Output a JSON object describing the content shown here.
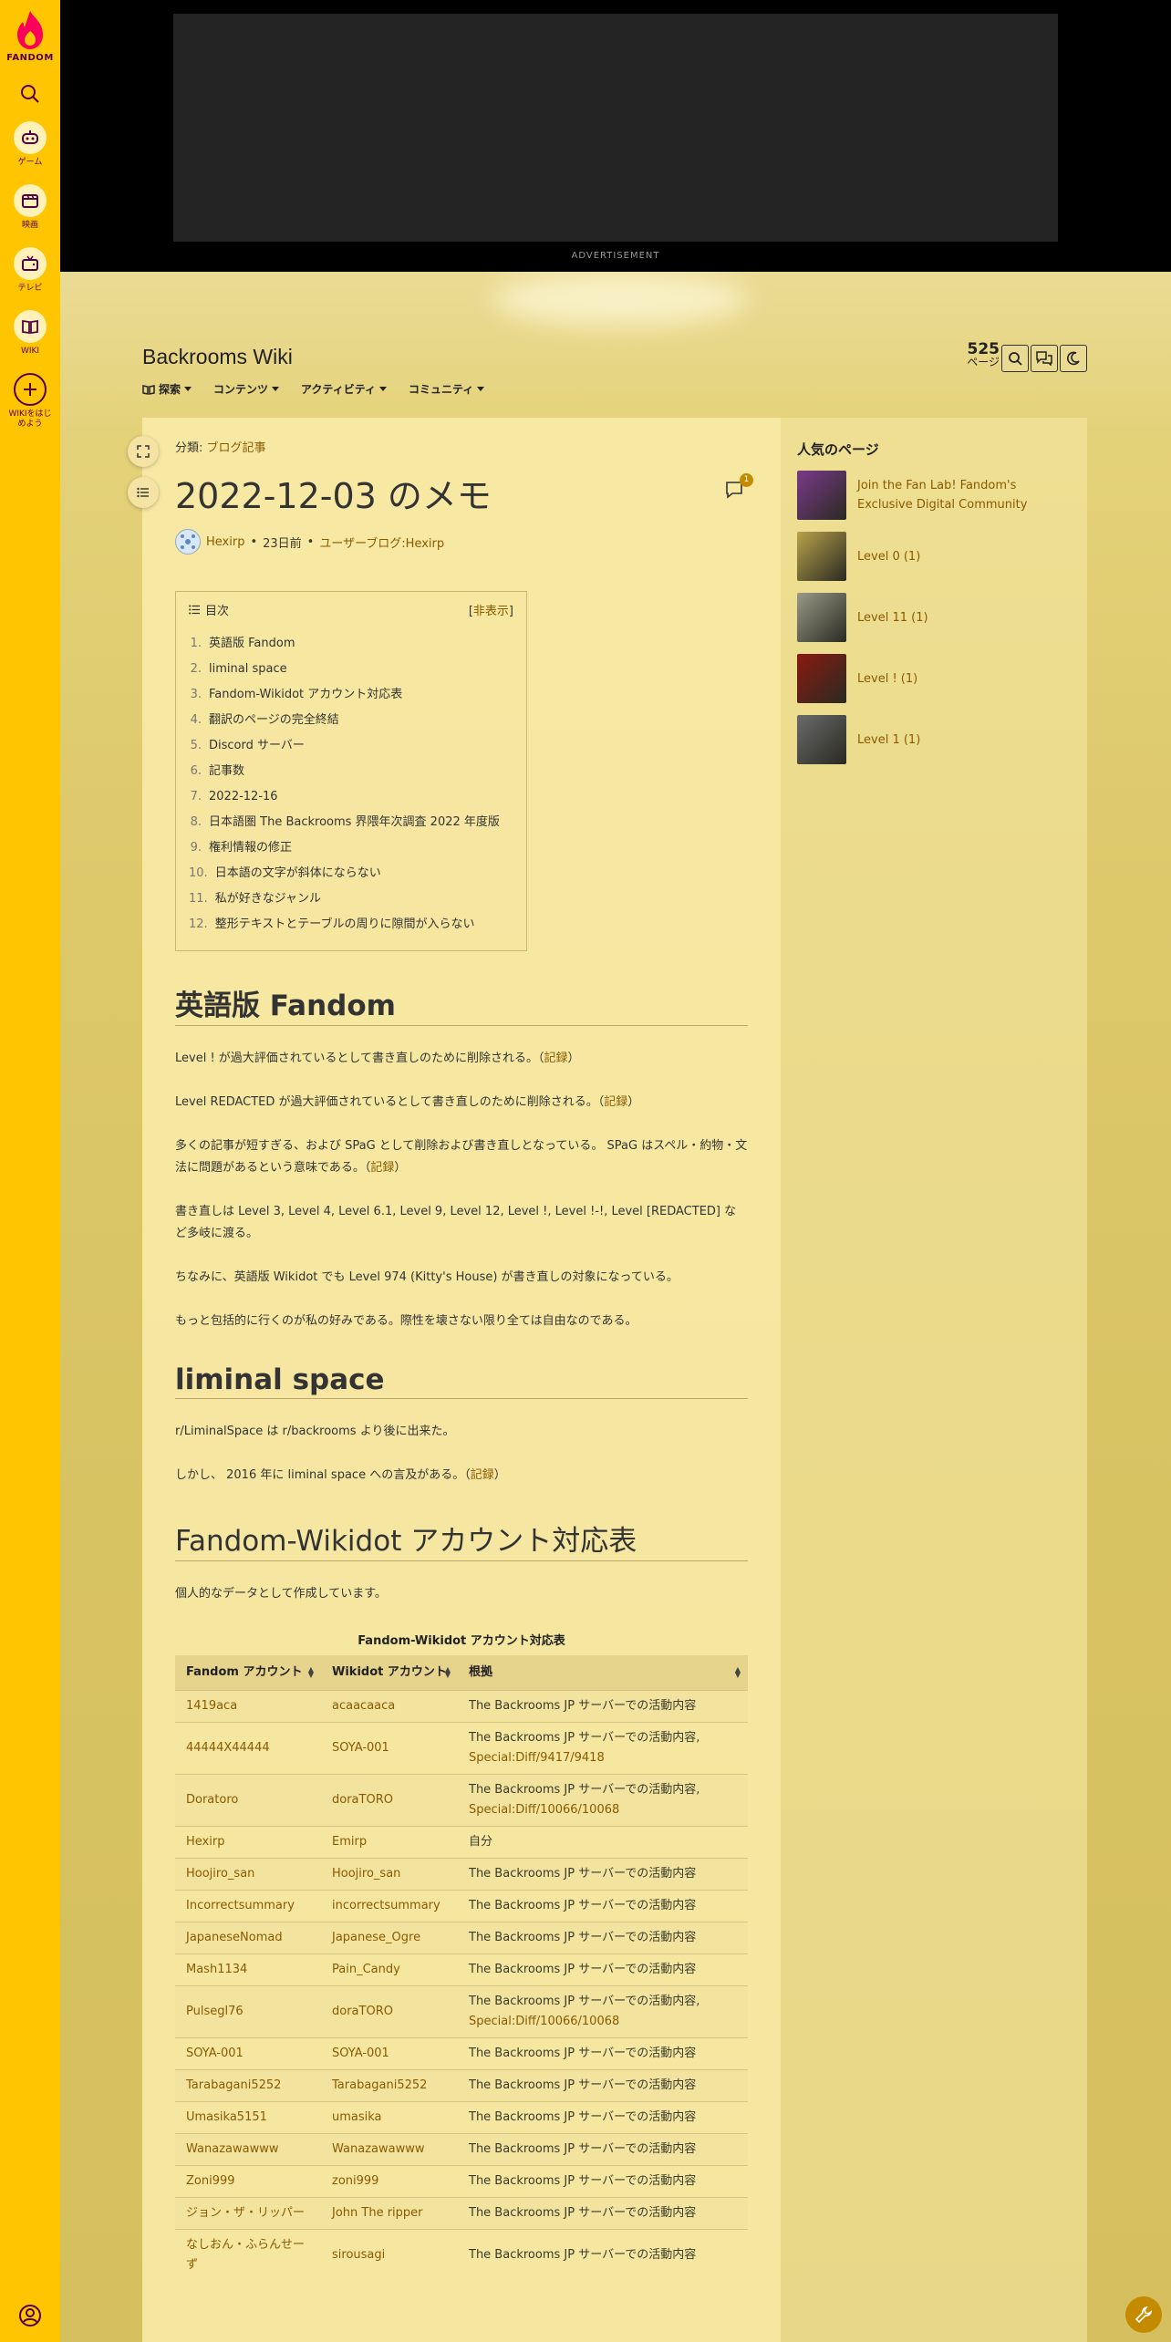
{
  "global_nav": {
    "logo_label": "FANDOM",
    "items": [
      {
        "label": "ゲーム",
        "icon": "gamepad-icon"
      },
      {
        "label": "映画",
        "icon": "film-icon"
      },
      {
        "label": "テレビ",
        "icon": "tv-icon"
      },
      {
        "label": "WIKI",
        "icon": "wiki-book-icon"
      }
    ],
    "start_wiki_label": "WIKIをはじめよう"
  },
  "ad": {
    "label": "ADVERTISEMENT"
  },
  "header": {
    "wiki_title": "Backrooms Wiki",
    "nav": [
      "探索",
      "コンテンツ",
      "アクティビティ",
      "コミュニティ"
    ],
    "page_count": "525",
    "page_count_unit": "ページ"
  },
  "article": {
    "category_prefix": "分類:",
    "category": "ブログ記事",
    "title": "2022-12-03 のメモ",
    "comment_count": "1",
    "author": "Hexirp",
    "time": "23日前",
    "blog": "ユーザーブログ:Hexirp",
    "sep": "•"
  },
  "toc": {
    "title": "目次",
    "hide_label": "非表示",
    "items": [
      {
        "n": "1.",
        "t": "英語版 Fandom"
      },
      {
        "n": "2.",
        "t": "liminal space"
      },
      {
        "n": "3.",
        "t": "Fandom-Wikidot アカウント対応表"
      },
      {
        "n": "4.",
        "t": "翻訳のページの完全終結"
      },
      {
        "n": "5.",
        "t": "Discord サーバー"
      },
      {
        "n": "6.",
        "t": "記事数"
      },
      {
        "n": "7.",
        "t": "2022-12-16"
      },
      {
        "n": "8.",
        "t": "日本語圏 The Backrooms 界隈年次調査 2022 年度版"
      },
      {
        "n": "9.",
        "t": "権利情報の修正"
      },
      {
        "n": "10.",
        "t": "日本語の文字が斜体にならない"
      },
      {
        "n": "11.",
        "t": "私が好きなジャンル"
      },
      {
        "n": "12.",
        "t": "整形テキストとテーブルの周りに隙間が入らない"
      }
    ]
  },
  "sections": {
    "s1": {
      "title": "英語版 Fandom",
      "p1": "Level ! が過大評価されているとして書き直しのために削除される。（",
      "p1_link": "記録",
      "p1_end": "）",
      "p2": "Level REDACTED が過大評価されているとして書き直しのために削除される。（",
      "p2_link": "記録",
      "p2_end": "）",
      "p3": "多くの記事が短すぎる、および SPaG として削除および書き直しとなっている。 SPaG はスペル・約物・文法に問題があるという意味である。（",
      "p3_link": "記録",
      "p3_end": "）",
      "p4": "書き直しは Level 3, Level 4, Level 6.1, Level 9, Level 12, Level !, Level !-!, Level [REDACTED] など多岐に渡る。",
      "p5": "ちなみに、英語版 Wikidot でも Level 974 (Kitty's House) が書き直しの対象になっている。",
      "p6": "もっと包括的に行くのが私の好みである。際性を壊さない限り全ては自由なのである。"
    },
    "s2": {
      "title": "liminal space",
      "p1": "r/LiminalSpace は r/backrooms より後に出来た。",
      "p2": "しかし、 2016 年に liminal space への言及がある。（",
      "p2_link": "記録",
      "p2_end": "）"
    },
    "s3": {
      "title": "Fandom-Wikidot アカウント対応表",
      "p1": "個人的なデータとして作成しています。",
      "caption": "Fandom-Wikidot アカウント対応表",
      "headers": [
        "Fandom アカウント",
        "Wikidot アカウント",
        "根拠"
      ],
      "rows": [
        {
          "f": "1419aca",
          "w": "acaacaaca",
          "r": "The Backrooms JP サーバーでの活動内容",
          "l": ""
        },
        {
          "f": "44444X44444",
          "w": "SOYA-001",
          "r": "The Backrooms JP サーバーでの活動内容,",
          "l": "Special:Diff/9417/9418"
        },
        {
          "f": "Doratoro",
          "w": "doraTORO",
          "r": "The Backrooms JP サーバーでの活動内容,",
          "l": "Special:Diff/10066/10068"
        },
        {
          "f": "Hexirp",
          "w": "Emirp",
          "r": "自分",
          "l": ""
        },
        {
          "f": "Hoojiro_san",
          "w": "Hoojiro_san",
          "r": "The Backrooms JP サーバーでの活動内容",
          "l": ""
        },
        {
          "f": "Incorrectsummary",
          "w": "incorrectsummary",
          "r": "The Backrooms JP サーバーでの活動内容",
          "l": ""
        },
        {
          "f": "JapaneseNomad",
          "w": "Japanese_Ogre",
          "r": "The Backrooms JP サーバーでの活動内容",
          "l": ""
        },
        {
          "f": "Mash1134",
          "w": "Pain_Candy",
          "r": "The Backrooms JP サーバーでの活動内容",
          "l": ""
        },
        {
          "f": "Pulsegl76",
          "w": "doraTORO",
          "r": "The Backrooms JP サーバーでの活動内容,",
          "l": "Special:Diff/10066/10068"
        },
        {
          "f": "SOYA-001",
          "w": "SOYA-001",
          "r": "The Backrooms JP サーバーでの活動内容",
          "l": ""
        },
        {
          "f": "Tarabagani5252",
          "w": "Tarabagani5252",
          "r": "The Backrooms JP サーバーでの活動内容",
          "l": ""
        },
        {
          "f": "Umasika5151",
          "w": "umasika",
          "r": "The Backrooms JP サーバーでの活動内容",
          "l": ""
        },
        {
          "f": "Wanazawawww",
          "w": "Wanazawawww",
          "r": "The Backrooms JP サーバーでの活動内容",
          "l": ""
        },
        {
          "f": "Zoni999",
          "w": "zoni999",
          "r": "The Backrooms JP サーバーでの活動内容",
          "l": ""
        },
        {
          "f": "ジョン・ザ・リッパー",
          "w": "John The ripper",
          "r": "The Backrooms JP サーバーでの活動内容",
          "l": ""
        },
        {
          "f": "なしおん・ふらんせーず",
          "w": "sirousagi",
          "r": "The Backrooms JP サーバーでの活動内容",
          "l": ""
        }
      ]
    }
  },
  "rail": {
    "title": "人気のページ",
    "items": [
      {
        "label": "Join the Fan Lab! Fandom's Exclusive Digital Community",
        "color": "#7a3a8a"
      },
      {
        "label": "Level 0 (1)",
        "color": "#b8a24a"
      },
      {
        "label": "Level 11 (1)",
        "color": "#9a9a88"
      },
      {
        "label": "Level ! (1)",
        "color": "#8a1a10"
      },
      {
        "label": "Level 1 (1)",
        "color": "#6a6a6a"
      }
    ]
  }
}
